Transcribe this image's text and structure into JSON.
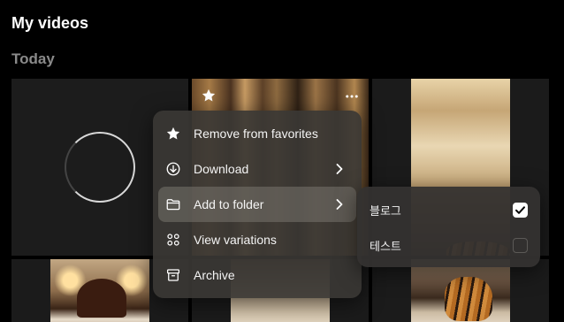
{
  "header": {
    "title": "My videos"
  },
  "section": {
    "title": "Today"
  },
  "grid": {
    "tiles": [
      {
        "name": "video-tile-loading",
        "kind": "loading"
      },
      {
        "name": "video-tile-curtain",
        "kind": "image"
      },
      {
        "name": "video-tile-tiger-bed",
        "kind": "image"
      },
      {
        "name": "video-tile-bedroom",
        "kind": "image"
      },
      {
        "name": "video-tile-tiger-bed-2",
        "kind": "image"
      }
    ]
  },
  "tile_actions": {
    "favorite_icon": "star-icon",
    "more_icon": "more-horizontal-icon"
  },
  "menu": {
    "items": [
      {
        "label": "Remove from favorites",
        "icon": "star-icon",
        "submenu": false
      },
      {
        "label": "Download",
        "icon": "download-icon",
        "submenu": true
      },
      {
        "label": "Add to folder",
        "icon": "folder-icon",
        "submenu": true,
        "active": true
      },
      {
        "label": "View variations",
        "icon": "grid-icon",
        "submenu": false
      },
      {
        "label": "Archive",
        "icon": "archive-icon",
        "submenu": false
      }
    ]
  },
  "folders": {
    "items": [
      {
        "label": "블로그",
        "checked": true
      },
      {
        "label": "테스트",
        "checked": false
      }
    ]
  },
  "colors": {
    "background": "#000000",
    "menu": "#3a3734",
    "active_item": "#78746e",
    "muted_text": "#8a8a8a"
  }
}
